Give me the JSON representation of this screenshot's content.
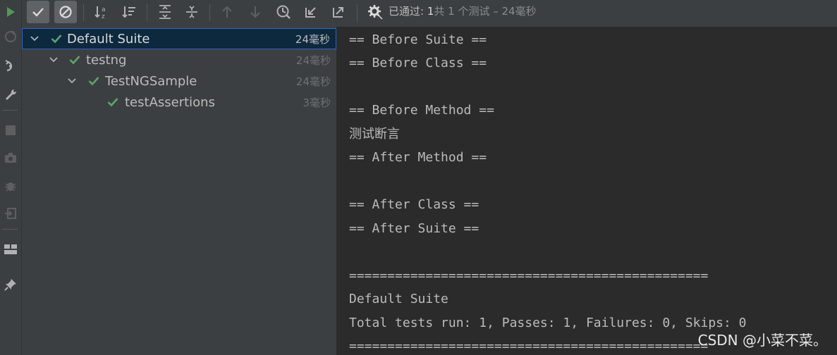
{
  "toolbar": {
    "buttons": [
      {
        "name": "show-passed-button",
        "icon": "check-icon",
        "pressed": true
      },
      {
        "name": "show-ignored-button",
        "icon": "ignored-icon",
        "pressed": true
      },
      {
        "name": "sort-alphabetically-button",
        "icon": "sort-alpha-icon"
      },
      {
        "name": "sort-by-duration-button",
        "icon": "sort-duration-icon"
      },
      {
        "name": "expand-all-button",
        "icon": "expand-all-icon"
      },
      {
        "name": "collapse-all-button",
        "icon": "collapse-all-icon"
      },
      {
        "name": "previous-failed-button",
        "icon": "arrow-up-icon"
      },
      {
        "name": "next-failed-button",
        "icon": "arrow-down-icon"
      },
      {
        "name": "test-history-button",
        "icon": "history-icon"
      },
      {
        "name": "import-tests-button",
        "icon": "import-icon"
      },
      {
        "name": "export-tests-button",
        "icon": "export-icon"
      },
      {
        "name": "settings-button",
        "icon": "gear-icon"
      }
    ],
    "status": {
      "prefix": "已通过: ",
      "passed": "1",
      "suffix": "共 1 个测试 – 24毫秒"
    }
  },
  "sidebar": {
    "icons": [
      "run-icon",
      "rerun-failed-icon",
      "toggle-auto-test-icon",
      "wrench-icon",
      "stop-icon",
      "camera-icon",
      "debug-icon",
      "exit-icon",
      "layout-icon",
      "pin-icon"
    ]
  },
  "tree": {
    "nodes": [
      {
        "label": "Default Suite",
        "time": "24毫秒",
        "depth": 0,
        "expanded": true,
        "selected": true
      },
      {
        "label": "testng",
        "time": "24毫秒",
        "depth": 1,
        "expanded": true
      },
      {
        "label": "TestNGSample",
        "time": "24毫秒",
        "depth": 2,
        "expanded": true
      },
      {
        "label": "testAssertions",
        "time": "3毫秒",
        "depth": 3,
        "expanded": null
      }
    ]
  },
  "console": {
    "lines": [
      "== Before Suite ==",
      "== Before Class ==",
      "",
      "== Before Method ==",
      "测试断言",
      "== After Method ==",
      "",
      "== After Class ==",
      "== After Suite ==",
      "",
      "===============================================",
      "Default Suite",
      "Total tests run: 1, Passes: 1, Failures: 0, Skips: 0",
      "==============================================="
    ]
  },
  "watermark": "CSDN @小菜不菜。",
  "colors": {
    "accent_green": "#59a869",
    "icon_gray": "#afb1b3",
    "disabled_gray": "#5e6060",
    "selection": "#0d293e"
  }
}
